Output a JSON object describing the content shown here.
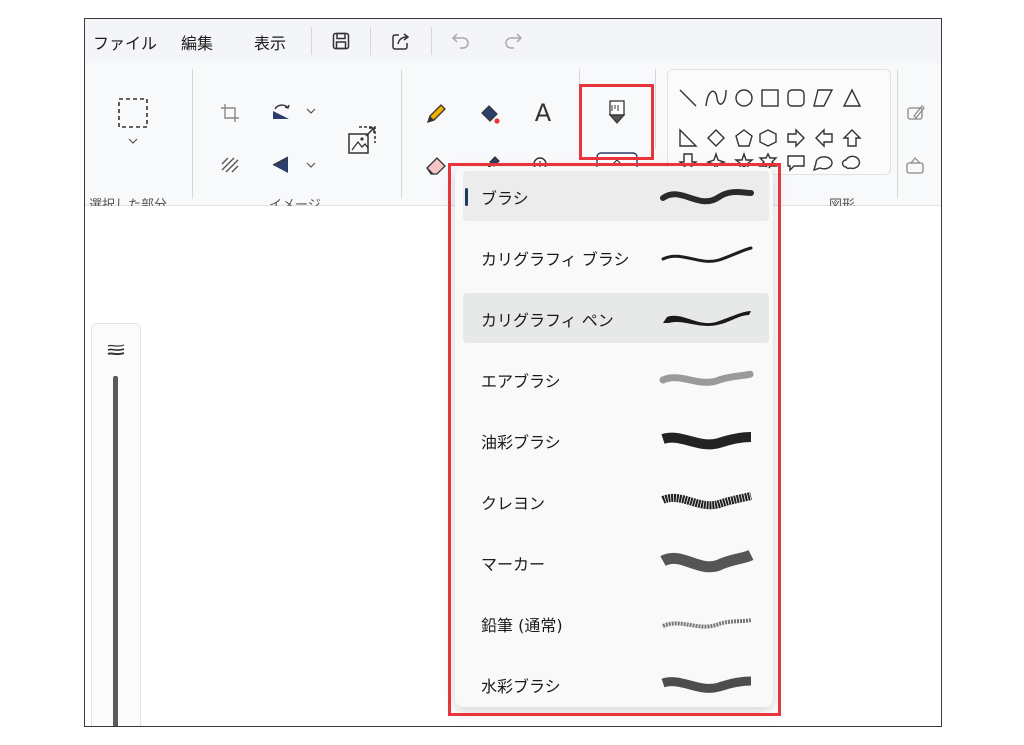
{
  "menubar": {
    "file": "ファイル",
    "edit": "編集",
    "view": "表示"
  },
  "ribbon": {
    "groups": {
      "selection": "選択した部分",
      "image": "イメージ",
      "shapes": "図形"
    }
  },
  "brush_menu": {
    "selected": "ブラシ",
    "items": [
      {
        "label": "ブラシ"
      },
      {
        "label": "カリグラフィ ブラシ"
      },
      {
        "label": "カリグラフィ ペン"
      },
      {
        "label": "エアブラシ"
      },
      {
        "label": "油彩ブラシ"
      },
      {
        "label": "クレヨン"
      },
      {
        "label": "マーカー"
      },
      {
        "label": "鉛筆 (通常)"
      },
      {
        "label": "水彩ブラシ"
      }
    ]
  },
  "colors": {
    "highlight_red": "#e8353b",
    "menu_bg": "#f3f5f8",
    "ribbon_bg": "#f8f9fb",
    "dropdown_bg": "#f9f9f9",
    "hover_item": "#e7e8e8"
  },
  "icons": [
    "save-icon",
    "share-icon",
    "undo-icon",
    "redo-icon",
    "select-icon",
    "crop-icon",
    "rotate-icon",
    "flip-icon",
    "resize-icon",
    "remove-bg-icon",
    "pencil-icon",
    "fill-icon",
    "text-icon",
    "eraser-icon",
    "color-picker-icon",
    "magnifier-icon",
    "brush-icon",
    "chevron-up-icon"
  ]
}
